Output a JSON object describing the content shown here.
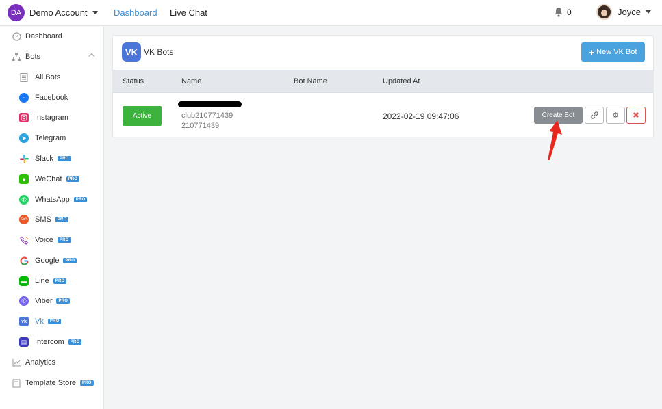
{
  "topbar": {
    "account_initials": "DA",
    "account_name": "Demo Account",
    "nav": [
      "Dashboard",
      "Live Chat"
    ],
    "notification_count": "0",
    "user_name": "Joyce"
  },
  "sidebar": {
    "pro_badge": "PRO",
    "items": [
      {
        "label": "Dashboard",
        "icon": "dashboard-gauge-icon",
        "pro": false
      },
      {
        "label": "Bots",
        "icon": "sitemap-icon",
        "pro": false
      },
      {
        "label": "All Bots",
        "icon": "list-icon",
        "pro": false
      },
      {
        "label": "Facebook",
        "icon": "messenger-icon",
        "pro": false,
        "color": "#1877f2"
      },
      {
        "label": "Instagram",
        "icon": "instagram-icon",
        "pro": false,
        "color": "#e1306c"
      },
      {
        "label": "Telegram",
        "icon": "telegram-icon",
        "pro": false,
        "color": "#2aa3e0"
      },
      {
        "label": "Slack",
        "icon": "slack-icon",
        "pro": true,
        "color": "#e01e5a"
      },
      {
        "label": "WeChat",
        "icon": "wechat-icon",
        "pro": true,
        "color": "#2dc100"
      },
      {
        "label": "WhatsApp",
        "icon": "whatsapp-icon",
        "pro": true,
        "color": "#25d366"
      },
      {
        "label": "SMS",
        "icon": "sms-icon",
        "pro": true,
        "color": "#f05a28"
      },
      {
        "label": "Voice",
        "icon": "voice-phone-icon",
        "pro": true,
        "color": "#8e44ad"
      },
      {
        "label": "Google",
        "icon": "google-icon",
        "pro": true,
        "color": "#4285f4"
      },
      {
        "label": "Line",
        "icon": "line-icon",
        "pro": true,
        "color": "#00b900"
      },
      {
        "label": "Viber",
        "icon": "viber-icon",
        "pro": true,
        "color": "#7360f2"
      },
      {
        "label": "Vk",
        "icon": "vk-icon",
        "pro": true,
        "color": "#4c75d8",
        "active": true
      },
      {
        "label": "Intercom",
        "icon": "intercom-icon",
        "pro": true,
        "color": "#3a3ab8"
      },
      {
        "label": "Analytics",
        "icon": "analytics-chart-icon",
        "pro": false
      },
      {
        "label": "Template Store",
        "icon": "template-store-icon",
        "pro": true
      }
    ]
  },
  "panel": {
    "title": "VK Bots",
    "logo_text": "VK",
    "new_button": "New VK Bot",
    "columns": [
      "Status",
      "Name",
      "Bot Name",
      "Updated At"
    ],
    "rows": [
      {
        "status": "Active",
        "name_line1": "club210771439",
        "name_line2": "210771439",
        "bot_name": "",
        "updated_at": "2022-02-19 09:47:06",
        "actions": {
          "create": "Create Bot",
          "link_icon": "link-icon",
          "settings_icon": "gear-icon",
          "delete_icon": "close-icon"
        }
      }
    ]
  },
  "colors": {
    "accent": "#3a8fd6",
    "new_button": "#4aa3df",
    "active_badge": "#3cb33c",
    "create_button": "#878d93",
    "delete": "#d9534f",
    "arrow": "#e8281e"
  }
}
